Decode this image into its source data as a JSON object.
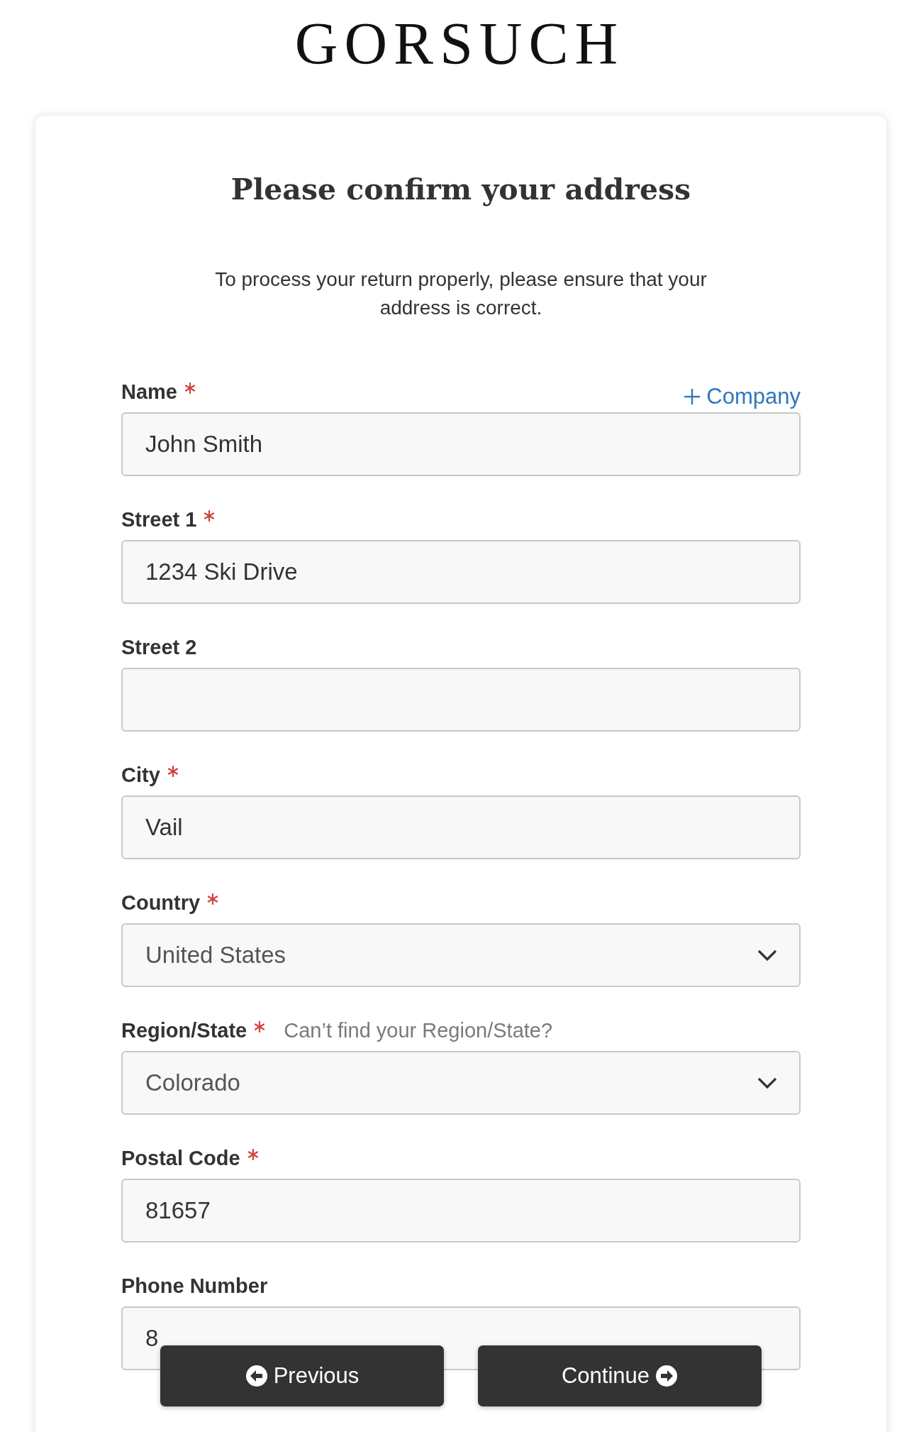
{
  "logo": "GORSUCH",
  "card": {
    "title": "Please confirm your address",
    "description": "To process your return properly, please ensure that your address is correct.",
    "fields": [
      {
        "label": "Name",
        "required": true,
        "kind": "text",
        "value": "John Smith",
        "link": "Company"
      },
      {
        "label": "Street 1",
        "required": true,
        "kind": "text",
        "value": "1234 Ski Drive"
      },
      {
        "label": "Street 2",
        "required": false,
        "kind": "text"
      },
      {
        "label": "City",
        "required": true,
        "kind": "text",
        "value": "Vail"
      },
      {
        "label": "Country",
        "required": true,
        "kind": "select",
        "value": "United States"
      },
      {
        "label": "Region/State",
        "required": true,
        "kind": "select",
        "value": "Colorado",
        "hint": "Can’t find your Region/State?"
      },
      {
        "label": "Postal Code",
        "required": true,
        "kind": "text",
        "value": "81657"
      },
      {
        "label": "Phone Number",
        "required": false,
        "kind": "text",
        "value": "8"
      }
    ]
  },
  "buttons": [
    {
      "label": "Previous",
      "kind": "back"
    },
    {
      "label": "Continue",
      "kind": "forward"
    }
  ]
}
